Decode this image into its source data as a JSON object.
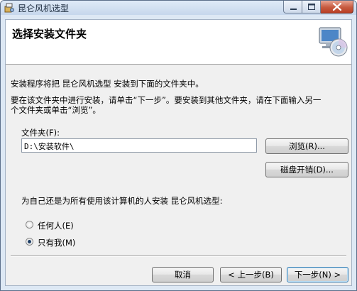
{
  "window": {
    "title": "昆仑风机选型"
  },
  "banner": {
    "title": "选择安装文件夹"
  },
  "description": {
    "line1": "安装程序将把 昆仑风机选型 安装到下面的文件夹中。",
    "line2": "要在该文件夹中进行安装，请单击“下一步”。要安装到其他文件夹，请在下面输入另一",
    "line3": "个文件夹或单击“浏览”。"
  },
  "folder": {
    "label": "文件夹(F):",
    "value": "D:\\安装软件\\",
    "browse_label": "浏览(R)...",
    "disk_cost_label": "磁盘开销(D)..."
  },
  "install_for": {
    "question": "为自己还是为所有使用该计算机的人安装 昆仑风机选型:",
    "options": [
      {
        "label": "任何人(E)",
        "selected": false
      },
      {
        "label": "只有我(M)",
        "selected": true
      }
    ]
  },
  "footer": {
    "cancel_label": "取消",
    "back_label": "< 上一步(B)",
    "next_label": "下一步(N) >"
  },
  "colors": {
    "frame": "#dde8f4",
    "close_button": "#c75a3f",
    "focus_border": "#3c7fb1"
  }
}
